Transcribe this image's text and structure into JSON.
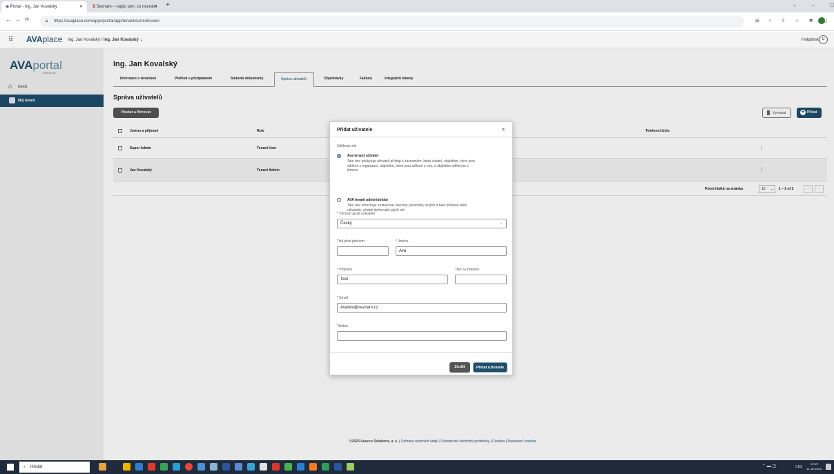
{
  "browser": {
    "tabs": [
      {
        "label": "Portal - Ing. Jan Kovalský"
      },
      {
        "label": "Seznam – najdu tam, co neznám"
      }
    ],
    "url": "https://avaplace.com/apps/portal/app/tenant/current/users"
  },
  "appbar": {
    "logo": "AVAplace",
    "breadcrumb_prefix": "Ing. Jan Kovalský /",
    "breadcrumb_current": "Ing. Jan Kovalský",
    "helpdesk": "Helpdesk",
    "avatar": "IJ"
  },
  "sidebar": {
    "logo_main": "AVA",
    "logo_accent": "portal",
    "powered": "Powered by",
    "items": [
      {
        "label": "Domů"
      },
      {
        "label": "Můj tenant"
      }
    ]
  },
  "page": {
    "title": "Ing. Jan Kovalský",
    "tabs": [
      {
        "label": "Informace o tenantovi"
      },
      {
        "label": "Přehled o předplatném"
      },
      {
        "label": "Smluvní dokumenty"
      },
      {
        "label": "Správa uživatelů"
      },
      {
        "label": "Objednávky"
      },
      {
        "label": "Faktury"
      },
      {
        "label": "Integrační tokeny"
      }
    ],
    "section_title": "Správa uživatelů",
    "filter_button": "Hledat a filtrovat",
    "delete_button": "Vymazat",
    "add_button": "Přidat",
    "table": {
      "headers": [
        "Jméno a příjmení",
        "Role",
        "Telefonní číslo"
      ],
      "rows": [
        {
          "name": "Super Admin",
          "role": "Tenant User"
        },
        {
          "name": "Jan Kovalský",
          "role": "Tenant Admin"
        }
      ]
    },
    "pagination": {
      "label": "Počet řádků na stránku",
      "page_size": "10",
      "range": "1 – 2 of 2"
    }
  },
  "footer": {
    "copyright": "©2023 Asseco Solutions, a. s.",
    "links": [
      "Ochrana osobních údajů",
      "Všeobecné obchodní podmínky",
      "Cookies",
      "Nastavení cookies"
    ]
  },
  "modal": {
    "title": "Přidat uživatele",
    "role_label": "Udělená role",
    "role_options": [
      {
        "title": "Ava tenant uživatel",
        "desc_lines": [
          "Tato role poskytuje uživateli přístup k záznamům, které vlastní, objektům, které jsou",
          "sdílené s organizací, objektům, které jsou sdílené s ním, a objektům sdíleným s",
          "týmem."
        ],
        "selected": true
      },
      {
        "title": "AVA tenant administrátor",
        "desc_lines": [
          "Tato role umožňuje nastavovat všechny parametry služeb a také přidávat další",
          "uživatele, včetně definování jejich rolí."
        ],
        "selected": false
      }
    ],
    "language_label": "Výchozí jazyk uživatele",
    "language_value": "Česky",
    "title_before_label": "Titul před jménem",
    "title_before_value": "",
    "first_name_label": "Jméno",
    "first_name_value": "Ava",
    "last_name_label": "Příjmení",
    "last_name_value": "Test",
    "title_after_label": "Titul za jménem",
    "title_after_value": "",
    "email_label": "Email",
    "email_value": "Avatest@seznam.cz",
    "phone_label": "Telefon",
    "phone_value": "",
    "cancel_button": "Zrušit",
    "submit_button": "Přidat uživatele"
  },
  "taskbar": {
    "search": "Hledat",
    "language": "CES",
    "time": "10:19",
    "date": "11.10.2023"
  },
  "colors": {
    "accent": "#1f4e6b",
    "sidebar_active": "#1f4e6b",
    "dark_button": "#555555",
    "avast_orange": "#f47b20",
    "taskbar": "#1f2b3a"
  }
}
